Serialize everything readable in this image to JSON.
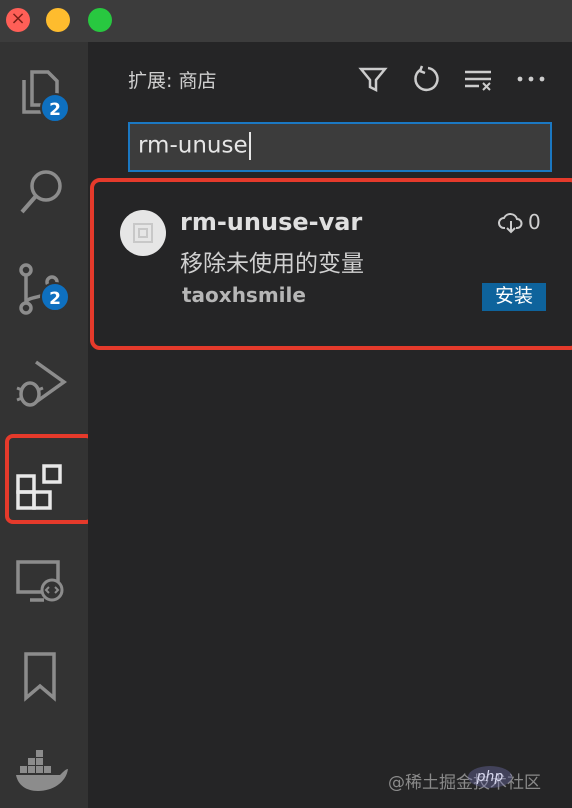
{
  "panel": {
    "title": "扩展: 商店",
    "toolbar": [
      {
        "name": "filter-icon"
      },
      {
        "name": "refresh-icon"
      },
      {
        "name": "clear-results-icon"
      },
      {
        "name": "more-icon"
      }
    ]
  },
  "search": {
    "value": "rm-unuse"
  },
  "activity_bar": {
    "items": [
      {
        "name": "explorer-icon",
        "badge": "2"
      },
      {
        "name": "search-icon"
      },
      {
        "name": "source-control-icon",
        "badge": "2"
      },
      {
        "name": "run-debug-icon"
      },
      {
        "name": "extensions-icon",
        "active": true
      },
      {
        "name": "remote-explorer-icon"
      },
      {
        "name": "bookmarks-icon"
      },
      {
        "name": "docker-icon"
      }
    ]
  },
  "extension": {
    "name": "rm-unuse-var",
    "description": "移除未使用的变量",
    "author": "taoxhsmile",
    "downloads": "0",
    "install_label": "安装"
  },
  "watermark": {
    "text": "@稀土掘金技术社区",
    "logo": "php"
  },
  "colors": {
    "accent": "#0e639c",
    "highlight": "#e53a2b",
    "badge": "#0e70c0"
  }
}
